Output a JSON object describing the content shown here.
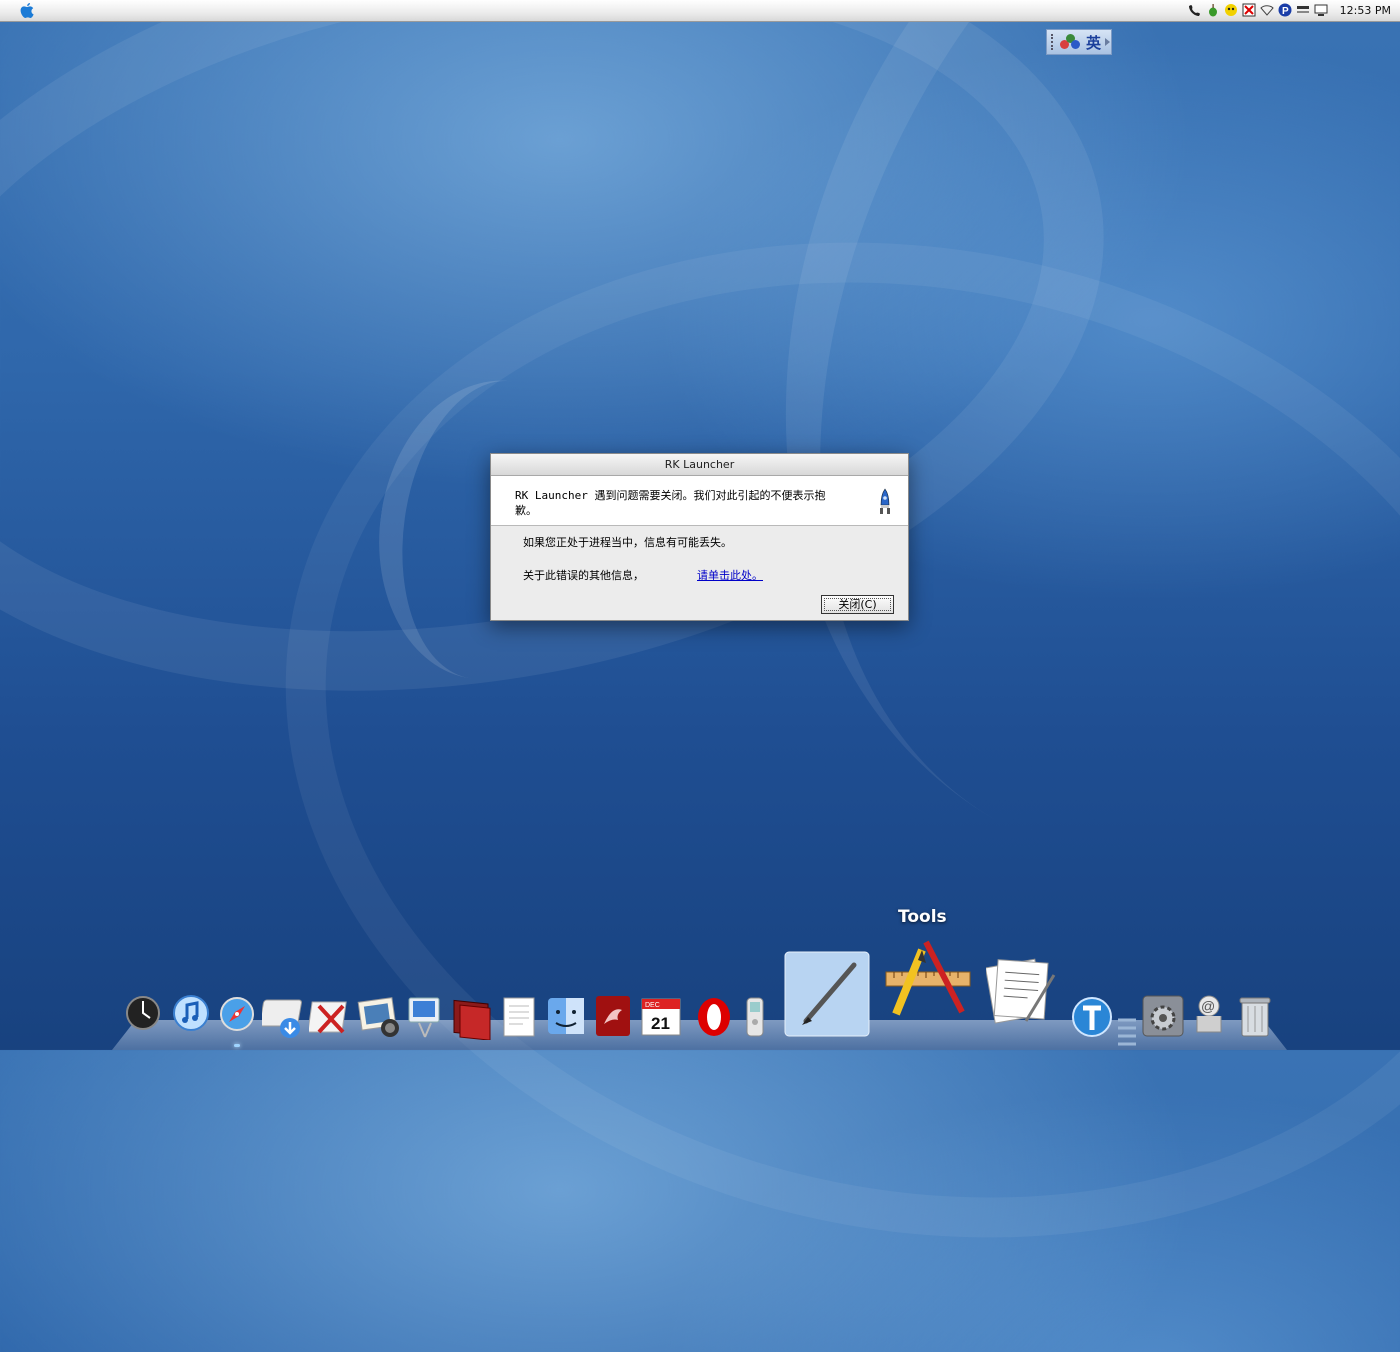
{
  "menubar": {
    "clock": "12:53 PM",
    "tray_icons": [
      "phone-icon",
      "pear-icon",
      "bird-icon",
      "antivirus-icon",
      "wifi-icon",
      "p-badge-icon",
      "battery-icon",
      "monitor-icon"
    ]
  },
  "ime": {
    "lang_label": "英"
  },
  "dialog": {
    "title": "RK Launcher",
    "message": "RK Launcher 遇到问题需要关闭。我们对此引起的不便表示抱歉。",
    "line1": "如果您正处于进程当中，信息有可能丢失。",
    "line2_label": "关于此错误的其他信息，",
    "line2_link": "请单击此处。",
    "close_button": "关闭(C)"
  },
  "dock": {
    "hover_label": "Tools",
    "items": [
      "dashboard-icon",
      "itunes-icon",
      "safari-icon",
      "downloads-icon",
      "x11-icon",
      "iphoto-icon",
      "imac-icon",
      "dictionary-icon",
      "textedit-doc-icon",
      "finder-icon",
      "dragon-app-icon",
      "calendar-icon",
      "opera-icon",
      "phone-app-icon",
      "pen-tool-icon",
      "xcode-tools-icon",
      "documents-icon",
      "typinator-icon",
      "system-preferences-icon",
      "mail-icon",
      "trash-icon"
    ],
    "calendar_day": "21",
    "calendar_month": "DEC"
  }
}
